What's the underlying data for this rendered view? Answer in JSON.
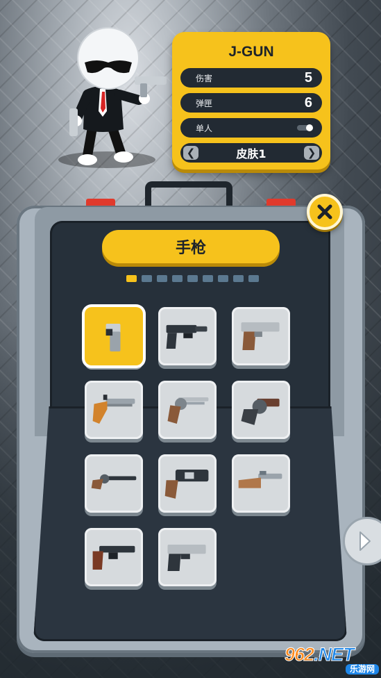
{
  "info_card": {
    "title": "J-GUN",
    "damage_label": "伤害",
    "damage_value": "5",
    "magazine_label": "弹匣",
    "magazine_value": "6",
    "fire_mode_label": "单人",
    "skin_label": "皮肤1",
    "prev_arrow": "❮",
    "next_arrow": "❯"
  },
  "category": {
    "label": "手枪"
  },
  "pagination": {
    "total": 9,
    "active_index": 0
  },
  "weapons": [
    {
      "name": "compact-pistol",
      "selected": true
    },
    {
      "name": "suppressed-pistol",
      "selected": false
    },
    {
      "name": "silver-pistol",
      "selected": false
    },
    {
      "name": "flintlock-pistol",
      "selected": false
    },
    {
      "name": "silver-revolver",
      "selected": false
    },
    {
      "name": "snub-revolver",
      "selected": false
    },
    {
      "name": "long-revolver",
      "selected": false
    },
    {
      "name": "heavy-revolver",
      "selected": false
    },
    {
      "name": "antique-pistol",
      "selected": false
    },
    {
      "name": "mauser-pistol",
      "selected": false
    },
    {
      "name": "dual-tone-pistol",
      "selected": false
    }
  ],
  "watermark": {
    "top": "962",
    "net": ".NET",
    "bottom": "乐游网"
  },
  "colors": {
    "accent": "#f6c21c",
    "panel": "#222a33",
    "case": "#a9b4be"
  },
  "icons": {
    "close": "close-icon",
    "next": "chevron-right-icon"
  }
}
